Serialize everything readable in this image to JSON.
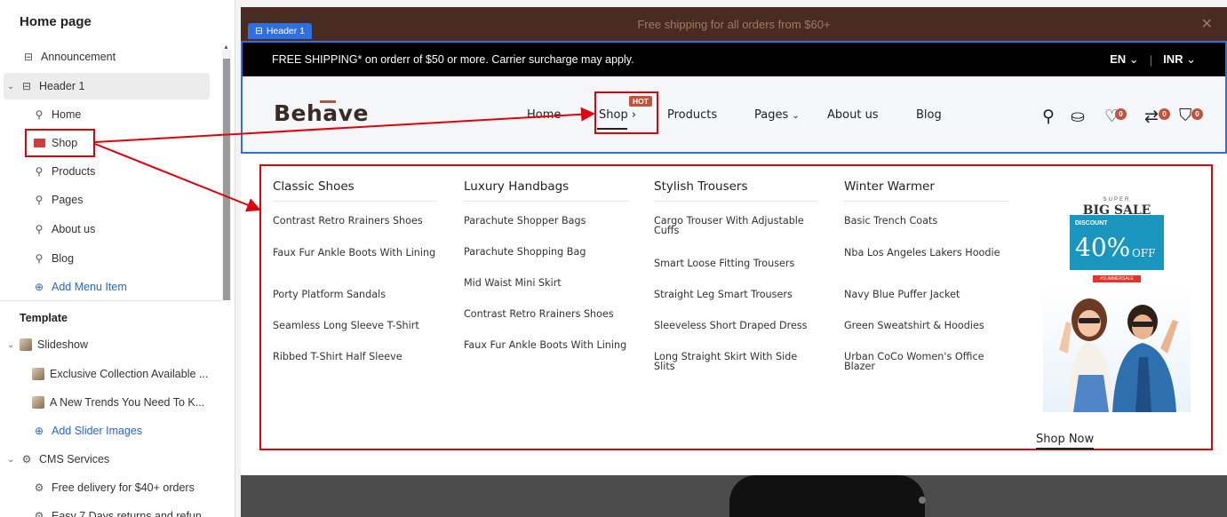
{
  "sidebar": {
    "title": "Home page",
    "items": [
      {
        "label": "Announcement",
        "icon": "layout-icon"
      },
      {
        "label": "Header 1",
        "icon": "layout-icon"
      },
      {
        "label": "Home",
        "icon": "link-icon"
      },
      {
        "label": "Shop",
        "icon": "image-icon"
      },
      {
        "label": "Products",
        "icon": "link-icon"
      },
      {
        "label": "Pages",
        "icon": "link-icon"
      },
      {
        "label": "About us",
        "icon": "link-icon"
      },
      {
        "label": "Blog",
        "icon": "link-icon"
      },
      {
        "label": "Add Menu Item",
        "icon": "plus-circle-icon"
      }
    ],
    "template_title": "Template",
    "template_items": [
      {
        "label": "Slideshow"
      },
      {
        "label": "Exclusive Collection Available ..."
      },
      {
        "label": "A New Trends You Need To K..."
      },
      {
        "label": "Add Slider Images"
      },
      {
        "label": "CMS Services"
      },
      {
        "label": "Free delivery for $40+ orders"
      },
      {
        "label": "Easy 7 Days returns and refun..."
      }
    ]
  },
  "preview": {
    "announcement": "Free shipping for all orders from $60+",
    "header_tag": "Header 1",
    "topbar_text": "FREE SHIPPING* on orderr of $50 or more. Carrier surcharge may apply.",
    "language": "EN",
    "currency": "INR",
    "logo": "Behave",
    "nav": [
      "Home",
      "Shop",
      "Products",
      "Pages",
      "About us",
      "Blog"
    ],
    "hot_badge": "HOT",
    "badge_counts": [
      "0",
      "0",
      "0"
    ],
    "mega_menu": [
      {
        "heading": "Classic Shoes",
        "items": [
          "Contrast Retro Rrainers Shoes",
          "Faux Fur Ankle Boots With Lining",
          "Porty Platform Sandals",
          "Seamless Long Sleeve T-Shirt",
          "Ribbed T-Shirt Half Sleeve"
        ]
      },
      {
        "heading": "Luxury Handbags",
        "items": [
          "Parachute Shopper Bags",
          "Parachute Shopping Bag",
          "Mid Waist Mini Skirt",
          "Contrast Retro Rrainers Shoes",
          "Faux Fur Ankle Boots With Lining"
        ]
      },
      {
        "heading": "Stylish Trousers",
        "items": [
          "Cargo Trouser With Adjustable Cuffs",
          "Smart Loose Fitting Trousers",
          "Straight Leg Smart Trousers",
          "Sleeveless Short Draped Dress",
          "Long Straight Skirt With Side Slits"
        ]
      },
      {
        "heading": "Winter Warmer",
        "items": [
          "Basic Trench Coats",
          "Nba Los Angeles Lakers Hoodie",
          "Navy Blue Puffer Jacket",
          "Green Sweatshirt & Hoodies",
          "Urban CoCo Women's Office Blazer"
        ]
      }
    ],
    "promo": {
      "super": "SUPER",
      "big_sale": "BIG SALE",
      "discount": "DISCOUNT",
      "percent": "40%",
      "off": "OFF",
      "tag": "#SUMMERSALE"
    },
    "shop_now": "Shop Now"
  },
  "colors": {
    "accent_blue": "#2f6fe0",
    "annotation_red": "#e0000a",
    "brand_brown": "#4a2b22",
    "badge_red": "#c0533d"
  }
}
